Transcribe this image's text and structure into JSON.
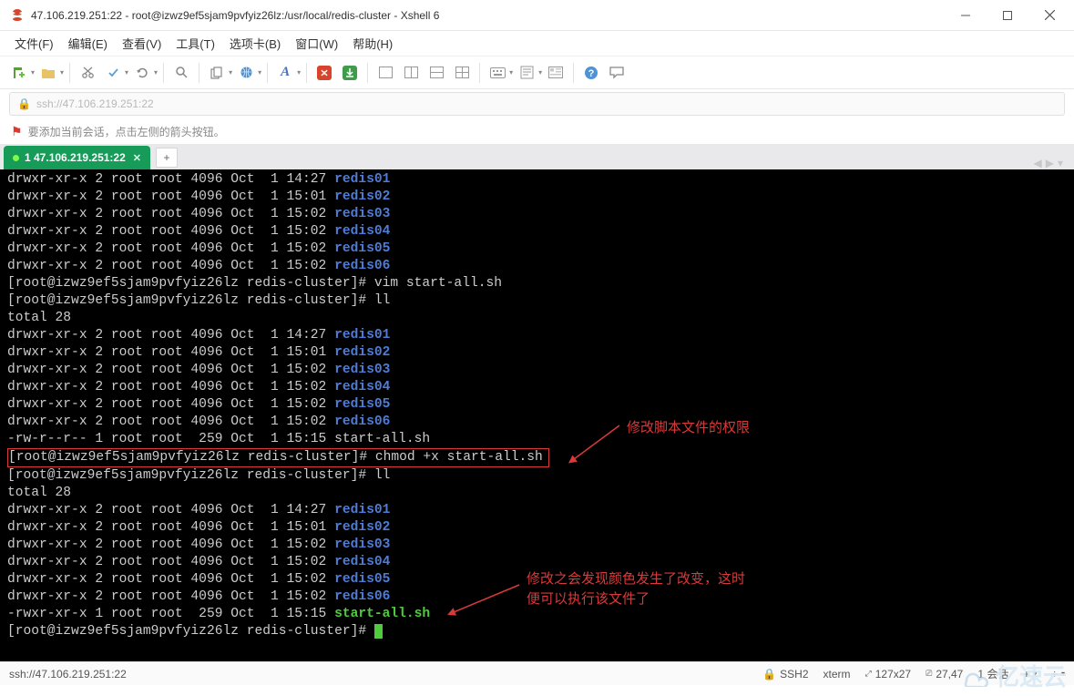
{
  "window": {
    "title": "47.106.219.251:22 - root@izwz9ef5sjam9pvfyiz26lz:/usr/local/redis-cluster - Xshell 6"
  },
  "menu": {
    "file": "文件(F)",
    "edit": "编辑(E)",
    "view": "查看(V)",
    "tools": "工具(T)",
    "tabs": "选项卡(B)",
    "window": "窗口(W)",
    "help": "帮助(H)"
  },
  "address": {
    "url": "ssh://47.106.219.251:22"
  },
  "hint": {
    "text": "要添加当前会话，点击左侧的箭头按钮。"
  },
  "tab": {
    "label": "1 47.106.219.251:22",
    "add": "+"
  },
  "annotations": {
    "a1": "修改脚本文件的权限",
    "a2l1": "修改之会发现颜色发生了改变，这时",
    "a2l2": "便可以执行该文件了"
  },
  "term": {
    "ls1": [
      {
        "perm": "drwxr-xr-x 2 root root 4096 Oct  1 14:27 ",
        "name": "redis01"
      },
      {
        "perm": "drwxr-xr-x 2 root root 4096 Oct  1 15:01 ",
        "name": "redis02"
      },
      {
        "perm": "drwxr-xr-x 2 root root 4096 Oct  1 15:02 ",
        "name": "redis03"
      },
      {
        "perm": "drwxr-xr-x 2 root root 4096 Oct  1 15:02 ",
        "name": "redis04"
      },
      {
        "perm": "drwxr-xr-x 2 root root 4096 Oct  1 15:02 ",
        "name": "redis05"
      },
      {
        "perm": "drwxr-xr-x 2 root root 4096 Oct  1 15:02 ",
        "name": "redis06"
      }
    ],
    "prompt": "[root@izwz9ef5sjam9pvfyiz26lz redis-cluster]# ",
    "cmd_vim": "vim start-all.sh",
    "cmd_ll": "ll",
    "total": "total 28",
    "plainfile": {
      "perm": "-rw-r--r-- 1 root root  259 Oct  1 15:15 ",
      "name": "start-all.sh"
    },
    "cmd_chmod": "chmod +x start-all.sh",
    "execfile": {
      "perm": "-rwxr-xr-x 1 root root  259 Oct  1 15:15 ",
      "name": "start-all.sh"
    }
  },
  "status": {
    "left": "ssh://47.106.219.251:22",
    "ssh": "SSH2",
    "term": "xterm",
    "size": "127x27",
    "pos": "27,47",
    "sess": "1 会话",
    "ext1": "+",
    "ext2": "÷"
  },
  "watermark": "亿速云"
}
